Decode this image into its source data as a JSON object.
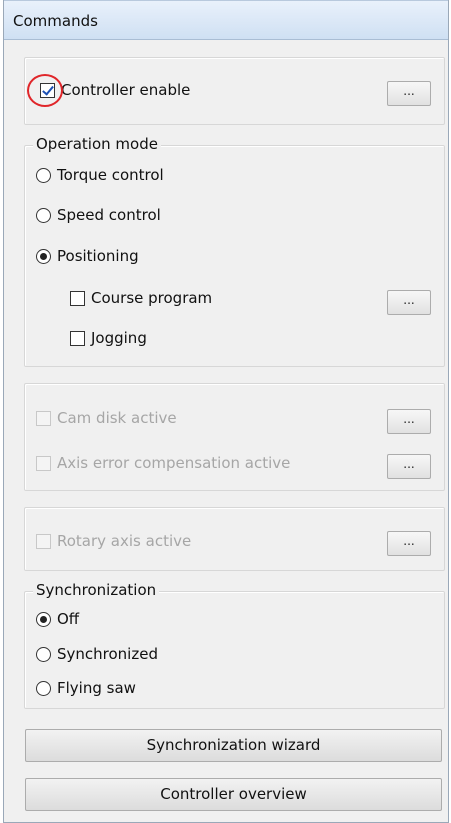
{
  "panel": {
    "title": "Commands"
  },
  "enable": {
    "label": "Controller enable",
    "checked": true,
    "more_label": "..."
  },
  "operation_mode": {
    "legend": "Operation mode",
    "options": [
      "Torque control",
      "Speed control",
      "Positioning"
    ],
    "selected": "Positioning",
    "course_program": {
      "label": "Course program",
      "checked": false,
      "more_label": "..."
    },
    "jogging": {
      "label": "Jogging",
      "checked": false
    }
  },
  "cam": {
    "cam_disk": {
      "label": "Cam disk active",
      "enabled": false,
      "more_label": "..."
    },
    "axis_error": {
      "label": "Axis error compensation active",
      "enabled": false,
      "more_label": "..."
    }
  },
  "rotary": {
    "label": "Rotary axis active",
    "enabled": false,
    "more_label": "..."
  },
  "synchronization": {
    "legend": "Synchronization",
    "options": [
      "Off",
      "Synchronized",
      "Flying saw"
    ],
    "selected": "Off"
  },
  "buttons": {
    "wizard": "Synchronization wizard",
    "overview": "Controller overview"
  },
  "colors": {
    "highlight_circle": "#e0262a",
    "check_mark": "#1b4fb3"
  }
}
